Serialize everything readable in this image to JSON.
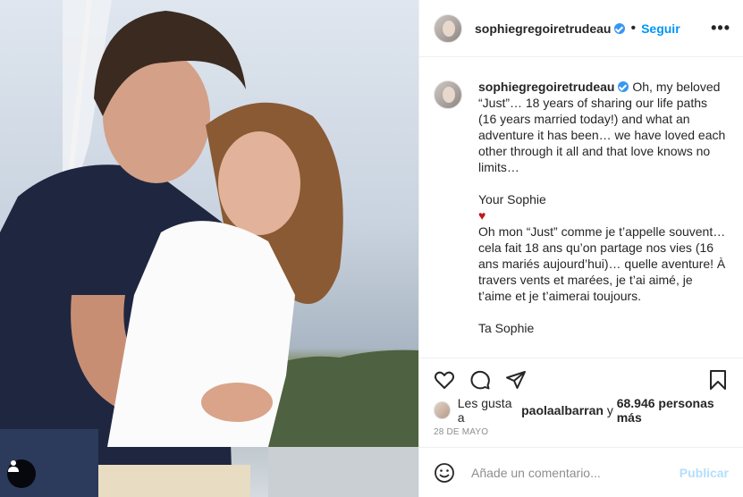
{
  "post": {
    "username": "sophiegregoiretrudeau",
    "follow_label": "Seguir",
    "dot": "•",
    "more": "•••",
    "caption": {
      "username": "sophiegregoiretrudeau",
      "text_en": "Oh, my beloved “Just”… 18 years of sharing our life paths (16 years married today!) and what an adventure it has been… we have loved each other through it all and that love knows no limits…",
      "signoff_en": "Your Sophie",
      "heart": "♥",
      "text_fr": "Oh mon “Just” comme je t’appelle souvent… cela fait 18 ans qu’on partage nos vies (16 ans mariés aujourd’hui)… quelle aventure! À travers vents et marées, je t’ai aimé, je t’aime et je t’aimerai toujours.",
      "signoff_fr": "Ta Sophie"
    },
    "likes": {
      "prefix": "Les gusta a",
      "user": "paolaalbarran",
      "connector": "y",
      "others": "68.946 personas más"
    },
    "date": "28 DE MAYO",
    "comment": {
      "placeholder": "Añade un comentario...",
      "publish_label": "Publicar"
    }
  },
  "colors": {
    "accent": "#0095f6",
    "verified": "#3897f0",
    "heart": "#c0171d",
    "publish_disabled": "#b2dffc"
  }
}
